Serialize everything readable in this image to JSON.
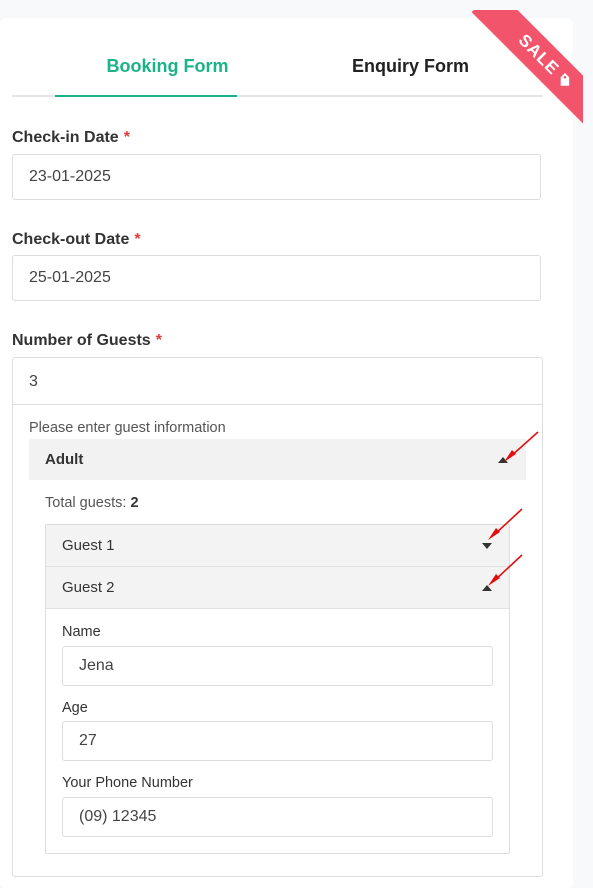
{
  "tabs": {
    "booking": "Booking Form",
    "enquiry": "Enquiry Form"
  },
  "ribbon": {
    "text": "SALE",
    "icon": "tag-icon",
    "color": "#f2546b"
  },
  "form": {
    "checkin": {
      "label": "Check-in Date",
      "required": "*",
      "value": "23-01-2025"
    },
    "checkout": {
      "label": "Check-out Date",
      "required": "*",
      "value": "25-01-2025"
    },
    "guests": {
      "label": "Number of Guests",
      "required": "*",
      "value": "3",
      "hint": "Please enter guest information",
      "group": {
        "label": "Adult",
        "expanded": true
      },
      "total_label": "Total guests:",
      "total_value": "2",
      "items": [
        {
          "label": "Guest 1",
          "expanded": false
        },
        {
          "label": "Guest 2",
          "expanded": true
        }
      ],
      "detail": {
        "name_label": "Name",
        "name_value": "Jena",
        "age_label": "Age",
        "age_value": "27",
        "phone_label": "Your Phone Number",
        "phone_value": "(09) 12345"
      }
    }
  },
  "colors": {
    "accent": "#1bb38a",
    "required": "#e23c3c",
    "annotation_arrow": "#e01010"
  }
}
